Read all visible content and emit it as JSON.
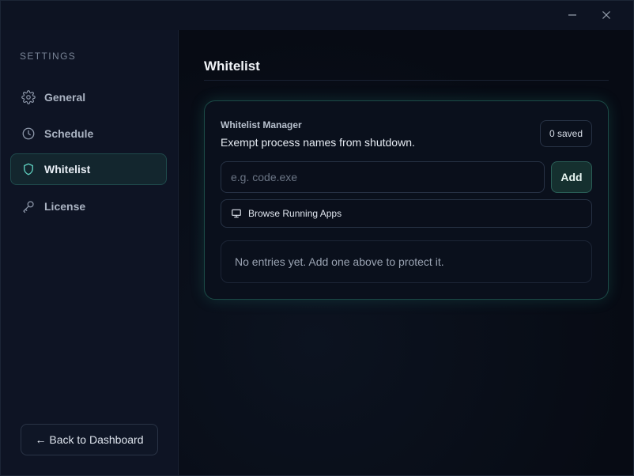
{
  "window": {
    "minimize_label": "—",
    "close_label": "✕"
  },
  "sidebar": {
    "heading": "SETTINGS",
    "items": [
      {
        "label": "General",
        "icon": "gear-icon",
        "active": false
      },
      {
        "label": "Schedule",
        "icon": "clock-icon",
        "active": false
      },
      {
        "label": "Whitelist",
        "icon": "shield-icon",
        "active": true
      },
      {
        "label": "License",
        "icon": "key-icon",
        "active": false
      }
    ],
    "back_label": "← Back to Dashboard"
  },
  "main": {
    "title": "Whitelist",
    "card": {
      "title": "Whitelist Manager",
      "subtitle": "Exempt process names from shutdown.",
      "saved_badge": "0 saved",
      "input_placeholder": "e.g. code.exe",
      "input_value": "",
      "add_label": "Add",
      "browse_label": "Browse Running Apps",
      "empty_text": "No entries yet. Add one above to protect it."
    }
  },
  "colors": {
    "accent": "#5fd1c0",
    "active_bg": "#13262e",
    "card_border": "#1b4a46",
    "background": "#080d17"
  }
}
